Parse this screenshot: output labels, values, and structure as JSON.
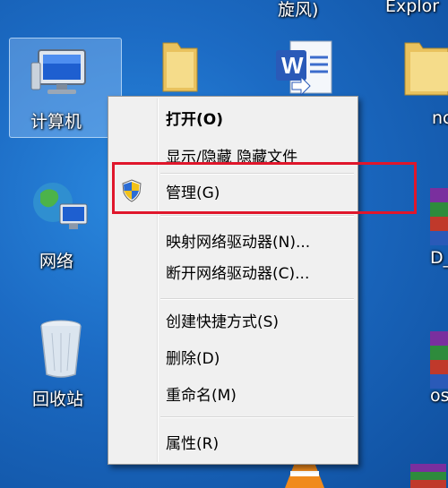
{
  "desktop": {
    "top_labels": [
      "旋风)",
      "Explor"
    ],
    "icons": {
      "computer": "计算机",
      "network": "网络",
      "recycle_bin": "回收站"
    },
    "partial_right_text": [
      "nc",
      "D_",
      "os"
    ]
  },
  "context_menu": {
    "items": [
      {
        "label": "打开(O)",
        "bold": true
      },
      {
        "label": "显示/隐藏 隐藏文件",
        "bold": false
      },
      {
        "label": "管理(G)",
        "bold": false,
        "icon": "shield-icon"
      },
      {
        "label": "映射网络驱动器(N)...",
        "bold": false
      },
      {
        "label": "断开网络驱动器(C)...",
        "bold": false
      },
      {
        "label": "创建快捷方式(S)",
        "bold": false
      },
      {
        "label": "删除(D)",
        "bold": false
      },
      {
        "label": "重命名(M)",
        "bold": false
      },
      {
        "label": "属性(R)",
        "bold": false
      }
    ]
  },
  "colors": {
    "highlight_border": "#e0162b",
    "desktop_blue": "#1c6bc4"
  }
}
